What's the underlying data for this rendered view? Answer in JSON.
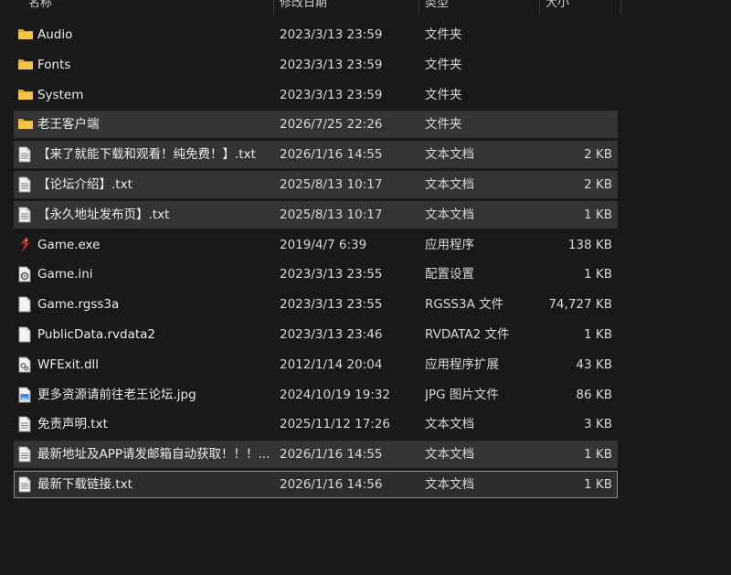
{
  "columns": {
    "name": "名称",
    "date": "修改日期",
    "type": "类型",
    "size": "大小"
  },
  "colors": {
    "folder": "#f4c44a",
    "background": "#191919",
    "highlight_row": "#343434"
  },
  "files": [
    {
      "icon": "folder-icon",
      "name": "Audio",
      "date": "2023/3/13 23:59",
      "type": "文件夹",
      "size": ""
    },
    {
      "icon": "folder-icon",
      "name": "Fonts",
      "date": "2023/3/13 23:59",
      "type": "文件夹",
      "size": ""
    },
    {
      "icon": "folder-icon",
      "name": "System",
      "date": "2023/3/13 23:59",
      "type": "文件夹",
      "size": ""
    },
    {
      "icon": "folder-icon",
      "name": "老王客户端",
      "date": "2026/7/25 22:26",
      "type": "文件夹",
      "size": ""
    },
    {
      "icon": "text-file-icon",
      "name": "【来了就能下载和观看！纯免费！】.txt",
      "date": "2026/1/16 14:55",
      "type": "文本文档",
      "size": "2 KB"
    },
    {
      "icon": "text-file-icon",
      "name": "【论坛介绍】.txt",
      "date": "2025/8/13 10:17",
      "type": "文本文档",
      "size": "2 KB"
    },
    {
      "icon": "text-file-icon",
      "name": "【永久地址发布页】.txt",
      "date": "2025/8/13 10:17",
      "type": "文本文档",
      "size": "1 KB"
    },
    {
      "icon": "exe-icon",
      "name": "Game.exe",
      "date": "2019/4/7 6:39",
      "type": "应用程序",
      "size": "138 KB"
    },
    {
      "icon": "settings-file-icon",
      "name": "Game.ini",
      "date": "2023/3/13 23:55",
      "type": "配置设置",
      "size": "1 KB"
    },
    {
      "icon": "blank-file-icon",
      "name": "Game.rgss3a",
      "date": "2023/3/13 23:55",
      "type": "RGSS3A 文件",
      "size": "74,727 KB"
    },
    {
      "icon": "blank-file-icon",
      "name": "PublicData.rvdata2",
      "date": "2023/3/13 23:46",
      "type": "RVDATA2 文件",
      "size": "1 KB"
    },
    {
      "icon": "dll-icon",
      "name": "WFExit.dll",
      "date": "2012/1/14 20:04",
      "type": "应用程序扩展",
      "size": "43 KB"
    },
    {
      "icon": "image-file-icon",
      "name": "更多资源请前往老王论坛.jpg",
      "date": "2024/10/19 19:32",
      "type": "JPG 图片文件",
      "size": "86 KB"
    },
    {
      "icon": "text-file-icon",
      "name": "免责声明.txt",
      "date": "2025/11/12 17:26",
      "type": "文本文档",
      "size": "3 KB"
    },
    {
      "icon": "text-file-icon",
      "name": "最新地址及APP请发邮箱自动获取！！！...",
      "date": "2026/1/16 14:55",
      "type": "文本文档",
      "size": "1 KB"
    },
    {
      "icon": "text-file-icon",
      "name": "最新下载链接.txt",
      "date": "2026/1/16 14:56",
      "type": "文本文档",
      "size": "1 KB"
    }
  ]
}
